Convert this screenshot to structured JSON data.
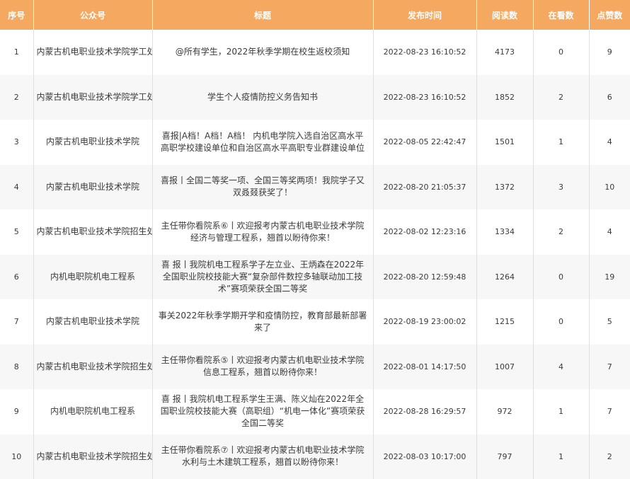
{
  "header": [
    "序号",
    "公众号",
    "标题",
    "发布时间",
    "阅读数",
    "在看数",
    "点赞数"
  ],
  "rows": [
    {
      "idx": "1",
      "account": "内蒙古机电职业技术学院学工处",
      "title": "@所有学生，2022年秋季学期在校生返校须知",
      "time": "2022-08-23 16:10:52",
      "reads": "4173",
      "watching": "0",
      "likes": "9"
    },
    {
      "idx": "2",
      "account": "内蒙古机电职业技术学院学工处",
      "title": "学生个人疫情防控义务告知书",
      "time": "2022-08-23 16:10:52",
      "reads": "1852",
      "watching": "2",
      "likes": "6"
    },
    {
      "idx": "3",
      "account": "内蒙古机电职业技术学院",
      "title": "喜报|A档！A档！A档！ 内机电学院入选自治区高水平高职学校建设单位和自治区高水平高职专业群建设单位",
      "time": "2022-08-05 22:42:47",
      "reads": "1501",
      "watching": "1",
      "likes": "4"
    },
    {
      "idx": "4",
      "account": "内蒙古机电职业技术学院",
      "title": "喜报丨全国二等奖一项、全国三等奖两项！我院学子又双叒叕获奖了！",
      "time": "2022-08-20 21:05:37",
      "reads": "1372",
      "watching": "3",
      "likes": "10"
    },
    {
      "idx": "5",
      "account": "内蒙古机电职业技术学院招生处",
      "title": "主任带你看院系⑥丨欢迎报考内蒙古机电职业技术学院经济与管理工程系，翘首以盼待你来！",
      "time": "2022-08-02 12:23:16",
      "reads": "1334",
      "watching": "2",
      "likes": "4"
    },
    {
      "idx": "6",
      "account": "内机电职院机电工程系",
      "title": "喜 报丨我院机电工程系学子左立业、王炳森在2022年全国职业院校技能大赛“复杂部件数控多轴联动加工技术”赛项荣获全国二等奖",
      "time": "2022-08-20 12:59:48",
      "reads": "1264",
      "watching": "0",
      "likes": "19"
    },
    {
      "idx": "7",
      "account": "内蒙古机电职业技术学院",
      "title": "事关2022年秋季学期开学和疫情防控，教育部最新部署来了",
      "time": "2022-08-19 23:00:02",
      "reads": "1215",
      "watching": "0",
      "likes": "5"
    },
    {
      "idx": "8",
      "account": "内蒙古机电职业技术学院招生处",
      "title": "主任带你看院系⑤丨欢迎报考内蒙古机电职业技术学院信息工程系，翘首以盼待你来！",
      "time": "2022-08-01 14:17:50",
      "reads": "1007",
      "watching": "4",
      "likes": "7"
    },
    {
      "idx": "9",
      "account": "内机电职院机电工程系",
      "title": "喜 报丨我院机电工程系学生王满、陈义灿在2022年全国职业院校技能大赛（高职组）“机电一体化”赛项荣获全国二等奖",
      "time": "2022-08-28 16:29:57",
      "reads": "972",
      "watching": "1",
      "likes": "7"
    },
    {
      "idx": "10",
      "account": "内蒙古机电职业技术学院招生处",
      "title": "主任带你看院系⑦丨欢迎报考内蒙古机电职业技术学院水利与土木建筑工程系，翘首以盼待你来！",
      "time": "2022-08-03 10:17:00",
      "reads": "797",
      "watching": "1",
      "likes": "2"
    }
  ]
}
